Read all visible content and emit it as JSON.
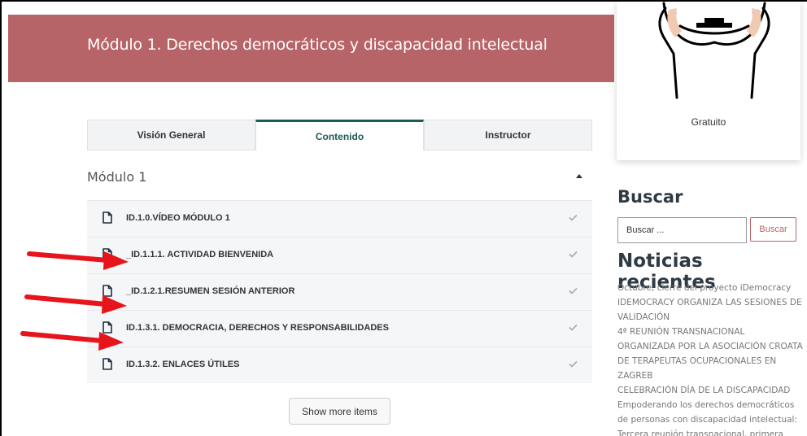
{
  "header": {
    "title": "Módulo 1. Derechos democráticos y discapacidad intelectual"
  },
  "course_card": {
    "price_label": "Gratuito"
  },
  "tabs": [
    {
      "label": "Visión General",
      "active": false
    },
    {
      "label": "Contenido",
      "active": true
    },
    {
      "label": "Instructor",
      "active": false
    }
  ],
  "module": {
    "title": "Módulo 1",
    "lessons": [
      {
        "label": "ID.1.0.VÍDEO MÓDULO 1"
      },
      {
        "label": "_ID.1.1.1. ACTIVIDAD BIENVENIDA"
      },
      {
        "label": "_ID.1.2.1.RESUMEN SESIÓN ANTERIOR"
      },
      {
        "label": "ID.1.3.1. DEMOCRACIA, DERECHOS Y RESPONSABILIDADES"
      },
      {
        "label": "ID.1.3.2. ENLACES ÚTILES"
      }
    ]
  },
  "show_more_label": "Show more items",
  "sidebar": {
    "search_heading": "Buscar",
    "search_placeholder": "Buscar ...",
    "search_button": "Buscar",
    "news_heading": "Noticias recientes",
    "news_items": [
      "Octubre, cierre del proyecto iDemocracy",
      "IDEMOCRACY ORGANIZA LAS SESIONES DE VALIDACIÓN",
      "4ª REUNIÓN TRANSNACIONAL ORGANIZADA POR LA ASOCIACIÓN CROATA DE TERAPEUTAS OCUPACIONALES EN ZAGREB",
      "CELEBRACIÓN DÍA DE LA DISCAPACIDAD",
      "Empoderando los derechos democráticos de personas con discapacidad intelectual: Tercera reunión transnacional, primera"
    ]
  },
  "colors": {
    "header_bg": "#b76468",
    "accent": "#1c5c58",
    "arrow": "#e8141b"
  }
}
